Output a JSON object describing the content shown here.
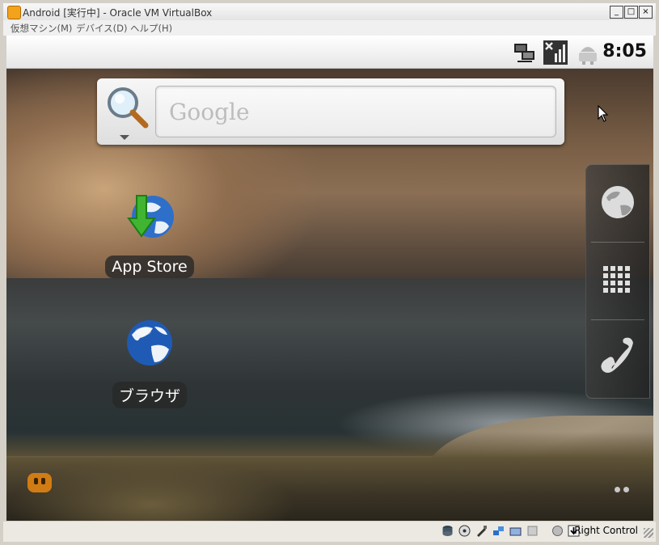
{
  "window": {
    "title": "Android [実行中] - Oracle VM VirtualBox",
    "buttons": [
      "_",
      "□",
      "×"
    ]
  },
  "menu": {
    "items": [
      "仮想マシン(M)",
      "デバイス(D)",
      "ヘルプ(H)"
    ]
  },
  "status_bar": {
    "time": "8:05",
    "icons": [
      "network-icon",
      "no-signal-icon",
      "android-usb-icon"
    ]
  },
  "search_widget": {
    "placeholder": "Google"
  },
  "desktop_icons": [
    {
      "label": "App Store",
      "icon": "app-store-icon"
    },
    {
      "label": "ブラウザ",
      "icon": "browser-globe-icon"
    }
  ],
  "dock": {
    "items": [
      "globe-icon",
      "app-drawer-grid-icon",
      "phone-icon"
    ]
  },
  "vbox_status": {
    "host_key": "Right Control",
    "icons": [
      "hard-disk-icon",
      "cd-icon",
      "usb-icon",
      "network-icon",
      "shared-folder-icon",
      "display-icon",
      "capture-icon",
      "mouse-integration-icon",
      "host-key-arrow-icon"
    ]
  },
  "colors": {
    "statusbar_bg": "#f0f0f0",
    "dock_bg": "#3a3a3a",
    "label_bg": "#282828"
  }
}
